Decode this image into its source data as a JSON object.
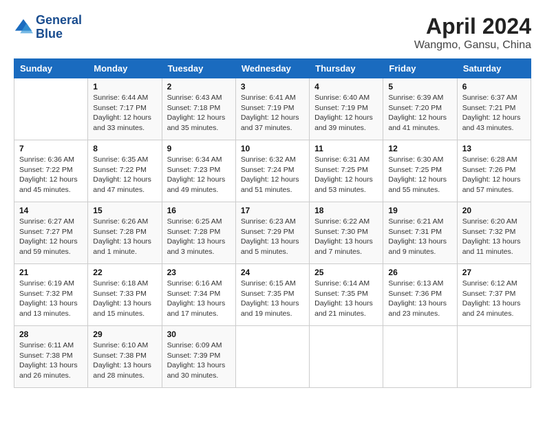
{
  "header": {
    "logo_line1": "General",
    "logo_line2": "Blue",
    "title": "April 2024",
    "location": "Wangmo, Gansu, China"
  },
  "weekdays": [
    "Sunday",
    "Monday",
    "Tuesday",
    "Wednesday",
    "Thursday",
    "Friday",
    "Saturday"
  ],
  "weeks": [
    [
      {
        "day": "",
        "sunrise": "",
        "sunset": "",
        "daylight": ""
      },
      {
        "day": "1",
        "sunrise": "Sunrise: 6:44 AM",
        "sunset": "Sunset: 7:17 PM",
        "daylight": "Daylight: 12 hours and 33 minutes."
      },
      {
        "day": "2",
        "sunrise": "Sunrise: 6:43 AM",
        "sunset": "Sunset: 7:18 PM",
        "daylight": "Daylight: 12 hours and 35 minutes."
      },
      {
        "day": "3",
        "sunrise": "Sunrise: 6:41 AM",
        "sunset": "Sunset: 7:19 PM",
        "daylight": "Daylight: 12 hours and 37 minutes."
      },
      {
        "day": "4",
        "sunrise": "Sunrise: 6:40 AM",
        "sunset": "Sunset: 7:19 PM",
        "daylight": "Daylight: 12 hours and 39 minutes."
      },
      {
        "day": "5",
        "sunrise": "Sunrise: 6:39 AM",
        "sunset": "Sunset: 7:20 PM",
        "daylight": "Daylight: 12 hours and 41 minutes."
      },
      {
        "day": "6",
        "sunrise": "Sunrise: 6:37 AM",
        "sunset": "Sunset: 7:21 PM",
        "daylight": "Daylight: 12 hours and 43 minutes."
      }
    ],
    [
      {
        "day": "7",
        "sunrise": "Sunrise: 6:36 AM",
        "sunset": "Sunset: 7:22 PM",
        "daylight": "Daylight: 12 hours and 45 minutes."
      },
      {
        "day": "8",
        "sunrise": "Sunrise: 6:35 AM",
        "sunset": "Sunset: 7:22 PM",
        "daylight": "Daylight: 12 hours and 47 minutes."
      },
      {
        "day": "9",
        "sunrise": "Sunrise: 6:34 AM",
        "sunset": "Sunset: 7:23 PM",
        "daylight": "Daylight: 12 hours and 49 minutes."
      },
      {
        "day": "10",
        "sunrise": "Sunrise: 6:32 AM",
        "sunset": "Sunset: 7:24 PM",
        "daylight": "Daylight: 12 hours and 51 minutes."
      },
      {
        "day": "11",
        "sunrise": "Sunrise: 6:31 AM",
        "sunset": "Sunset: 7:25 PM",
        "daylight": "Daylight: 12 hours and 53 minutes."
      },
      {
        "day": "12",
        "sunrise": "Sunrise: 6:30 AM",
        "sunset": "Sunset: 7:25 PM",
        "daylight": "Daylight: 12 hours and 55 minutes."
      },
      {
        "day": "13",
        "sunrise": "Sunrise: 6:28 AM",
        "sunset": "Sunset: 7:26 PM",
        "daylight": "Daylight: 12 hours and 57 minutes."
      }
    ],
    [
      {
        "day": "14",
        "sunrise": "Sunrise: 6:27 AM",
        "sunset": "Sunset: 7:27 PM",
        "daylight": "Daylight: 12 hours and 59 minutes."
      },
      {
        "day": "15",
        "sunrise": "Sunrise: 6:26 AM",
        "sunset": "Sunset: 7:28 PM",
        "daylight": "Daylight: 13 hours and 1 minute."
      },
      {
        "day": "16",
        "sunrise": "Sunrise: 6:25 AM",
        "sunset": "Sunset: 7:28 PM",
        "daylight": "Daylight: 13 hours and 3 minutes."
      },
      {
        "day": "17",
        "sunrise": "Sunrise: 6:23 AM",
        "sunset": "Sunset: 7:29 PM",
        "daylight": "Daylight: 13 hours and 5 minutes."
      },
      {
        "day": "18",
        "sunrise": "Sunrise: 6:22 AM",
        "sunset": "Sunset: 7:30 PM",
        "daylight": "Daylight: 13 hours and 7 minutes."
      },
      {
        "day": "19",
        "sunrise": "Sunrise: 6:21 AM",
        "sunset": "Sunset: 7:31 PM",
        "daylight": "Daylight: 13 hours and 9 minutes."
      },
      {
        "day": "20",
        "sunrise": "Sunrise: 6:20 AM",
        "sunset": "Sunset: 7:32 PM",
        "daylight": "Daylight: 13 hours and 11 minutes."
      }
    ],
    [
      {
        "day": "21",
        "sunrise": "Sunrise: 6:19 AM",
        "sunset": "Sunset: 7:32 PM",
        "daylight": "Daylight: 13 hours and 13 minutes."
      },
      {
        "day": "22",
        "sunrise": "Sunrise: 6:18 AM",
        "sunset": "Sunset: 7:33 PM",
        "daylight": "Daylight: 13 hours and 15 minutes."
      },
      {
        "day": "23",
        "sunrise": "Sunrise: 6:16 AM",
        "sunset": "Sunset: 7:34 PM",
        "daylight": "Daylight: 13 hours and 17 minutes."
      },
      {
        "day": "24",
        "sunrise": "Sunrise: 6:15 AM",
        "sunset": "Sunset: 7:35 PM",
        "daylight": "Daylight: 13 hours and 19 minutes."
      },
      {
        "day": "25",
        "sunrise": "Sunrise: 6:14 AM",
        "sunset": "Sunset: 7:35 PM",
        "daylight": "Daylight: 13 hours and 21 minutes."
      },
      {
        "day": "26",
        "sunrise": "Sunrise: 6:13 AM",
        "sunset": "Sunset: 7:36 PM",
        "daylight": "Daylight: 13 hours and 23 minutes."
      },
      {
        "day": "27",
        "sunrise": "Sunrise: 6:12 AM",
        "sunset": "Sunset: 7:37 PM",
        "daylight": "Daylight: 13 hours and 24 minutes."
      }
    ],
    [
      {
        "day": "28",
        "sunrise": "Sunrise: 6:11 AM",
        "sunset": "Sunset: 7:38 PM",
        "daylight": "Daylight: 13 hours and 26 minutes."
      },
      {
        "day": "29",
        "sunrise": "Sunrise: 6:10 AM",
        "sunset": "Sunset: 7:38 PM",
        "daylight": "Daylight: 13 hours and 28 minutes."
      },
      {
        "day": "30",
        "sunrise": "Sunrise: 6:09 AM",
        "sunset": "Sunset: 7:39 PM",
        "daylight": "Daylight: 13 hours and 30 minutes."
      },
      {
        "day": "",
        "sunrise": "",
        "sunset": "",
        "daylight": ""
      },
      {
        "day": "",
        "sunrise": "",
        "sunset": "",
        "daylight": ""
      },
      {
        "day": "",
        "sunrise": "",
        "sunset": "",
        "daylight": ""
      },
      {
        "day": "",
        "sunrise": "",
        "sunset": "",
        "daylight": ""
      }
    ]
  ]
}
